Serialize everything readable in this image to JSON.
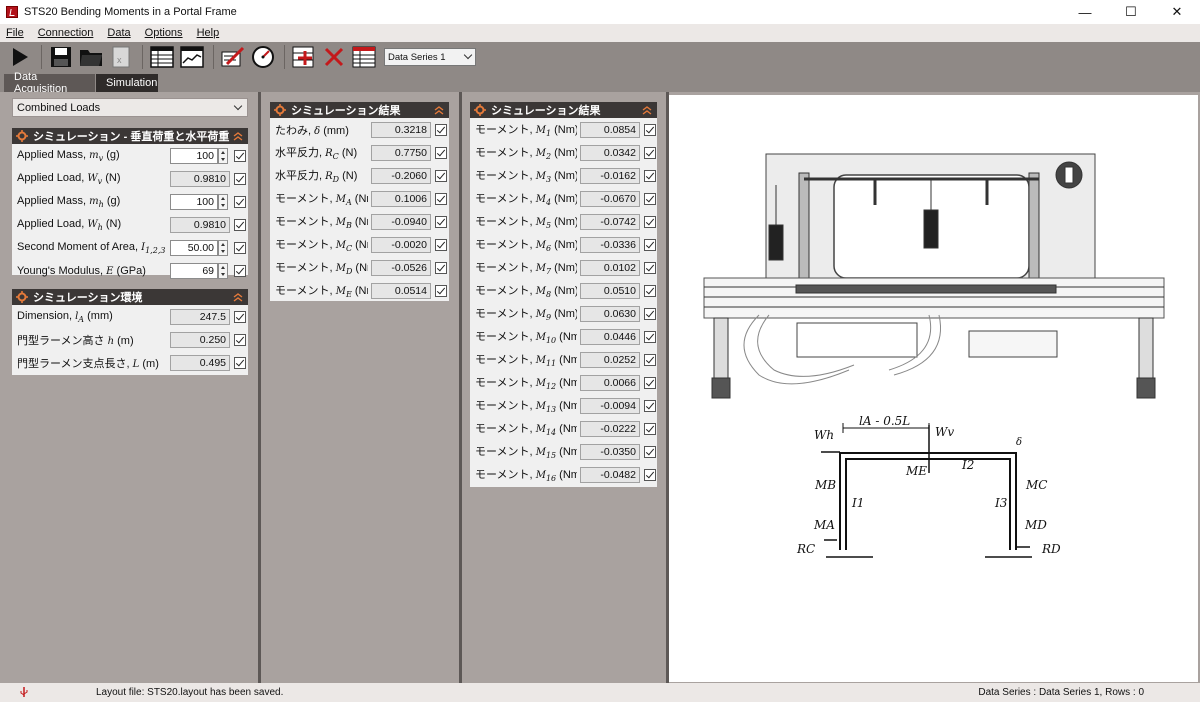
{
  "window": {
    "title": "STS20 Bending Moments in a Portal Frame"
  },
  "menu": [
    "File",
    "Connection",
    "Data",
    "Options",
    "Help"
  ],
  "toolbar": {
    "icons": [
      "play-icon",
      "save-icon",
      "open-folder-icon",
      "export-excel-icon",
      "table-icon",
      "chart-icon",
      "edit-calibrate-icon",
      "gauge-icon",
      "add-row-icon",
      "delete-icon",
      "table-edit-icon"
    ],
    "series_select": "Data Series 1"
  },
  "tabs": [
    {
      "label": "Data Acquisition",
      "active": false
    },
    {
      "label": "Simulation",
      "active": true
    }
  ],
  "load_case_select": "Combined Loads",
  "panel_loads": {
    "title": "シミュレーション - 垂直荷重と水平荷重",
    "rows": [
      {
        "label": "Applied Mass, ",
        "sym": "mv",
        "unit": " (g)",
        "value": "100",
        "editable": true
      },
      {
        "label": "Applied Load, ",
        "sym": "Wv",
        "unit": " (N)",
        "value": "0.9810",
        "editable": false
      },
      {
        "label": "Applied Mass, ",
        "sym": "mh",
        "unit": " (g)",
        "value": "100",
        "editable": true
      },
      {
        "label": "Applied Load, ",
        "sym": "Wh",
        "unit": " (N)",
        "value": "0.9810",
        "editable": false
      },
      {
        "label": "Second Moment of Area, ",
        "sym": "I1,2,3",
        "unit": " (mm",
        "value": "50.00",
        "editable": true
      },
      {
        "label": "Young's Modulus, ",
        "sym": "E",
        "unit": " (GPa)",
        "value": "69",
        "editable": true
      }
    ]
  },
  "panel_env": {
    "title": "シミュレーション環境",
    "rows": [
      {
        "label": "Dimension, ",
        "sym": "lA",
        "unit": " (mm)",
        "value": "247.5"
      },
      {
        "label": "門型ラーメン高さ ",
        "sym": "h",
        "unit": " (m)",
        "value": "0.250"
      },
      {
        "label": "門型ラーメン支点長さ, ",
        "sym": "L",
        "unit": " (m)",
        "value": "0.495"
      }
    ]
  },
  "panel_results1": {
    "title": "シミュレーション結果",
    "rows": [
      {
        "label": "たわみ, ",
        "sym": "δ",
        "unit": " (mm)",
        "value": "0.3218"
      },
      {
        "label": "水平反力, ",
        "sym": "RC",
        "unit": " (N)",
        "value": "0.7750"
      },
      {
        "label": "水平反力, ",
        "sym": "RD",
        "unit": " (N)",
        "value": "-0.2060"
      },
      {
        "label": "モーメント, ",
        "sym": "MA",
        "unit": " (Nm)",
        "value": "0.1006"
      },
      {
        "label": "モーメント, ",
        "sym": "MB",
        "unit": " (Nm)",
        "value": "-0.0940"
      },
      {
        "label": "モーメント, ",
        "sym": "MC",
        "unit": " (Nm)",
        "value": "-0.0020"
      },
      {
        "label": "モーメント, ",
        "sym": "MD",
        "unit": " (Nm)",
        "value": "-0.0526"
      },
      {
        "label": "モーメント, ",
        "sym": "ME",
        "unit": " (Nm)",
        "value": "0.0514"
      }
    ]
  },
  "panel_results2": {
    "title": "シミュレーション結果",
    "rows": [
      {
        "label": "モーメント, ",
        "sym": "M1",
        "unit": " (Nm)",
        "value": "0.0854"
      },
      {
        "label": "モーメント, ",
        "sym": "M2",
        "unit": " (Nm)",
        "value": "0.0342"
      },
      {
        "label": "モーメント, ",
        "sym": "M3",
        "unit": " (Nm)",
        "value": "-0.0162"
      },
      {
        "label": "モーメント, ",
        "sym": "M4",
        "unit": " (Nm)",
        "value": "-0.0670"
      },
      {
        "label": "モーメント, ",
        "sym": "M5",
        "unit": " (Nm)",
        "value": "-0.0742"
      },
      {
        "label": "モーメント, ",
        "sym": "M6",
        "unit": " (Nm)",
        "value": "-0.0336"
      },
      {
        "label": "モーメント, ",
        "sym": "M7",
        "unit": " (Nm)",
        "value": "0.0102"
      },
      {
        "label": "モーメント, ",
        "sym": "M8",
        "unit": " (Nm)",
        "value": "0.0510"
      },
      {
        "label": "モーメント, ",
        "sym": "M9",
        "unit": " (Nm)",
        "value": "0.0630"
      },
      {
        "label": "モーメント, ",
        "sym": "M10",
        "unit": " (Nm)",
        "value": "0.0446"
      },
      {
        "label": "モーメント, ",
        "sym": "M11",
        "unit": " (Nm)",
        "value": "0.0252"
      },
      {
        "label": "モーメント, ",
        "sym": "M12",
        "unit": " (Nm)",
        "value": "0.0066"
      },
      {
        "label": "モーメント, ",
        "sym": "M13",
        "unit": " (Nm)",
        "value": "-0.0094"
      },
      {
        "label": "モーメント, ",
        "sym": "M14",
        "unit": " (Nm)",
        "value": "-0.0222"
      },
      {
        "label": "モーメント, ",
        "sym": "M15",
        "unit": " (Nm)",
        "value": "-0.0350"
      },
      {
        "label": "モーメント, ",
        "sym": "M16",
        "unit": " (Nm)",
        "value": "-0.0482"
      }
    ]
  },
  "diagram": {
    "dim_label": "lA - 0.5L",
    "labels": [
      "Wh",
      "Wv",
      "δ",
      "ME",
      "I2",
      "MB",
      "I1",
      "I3",
      "MC",
      "MA",
      "MD",
      "RC",
      "RD"
    ]
  },
  "status": {
    "message": "Layout file: STS20.layout has been saved.",
    "right": "Data Series : Data Series 1,  Rows : 0"
  }
}
